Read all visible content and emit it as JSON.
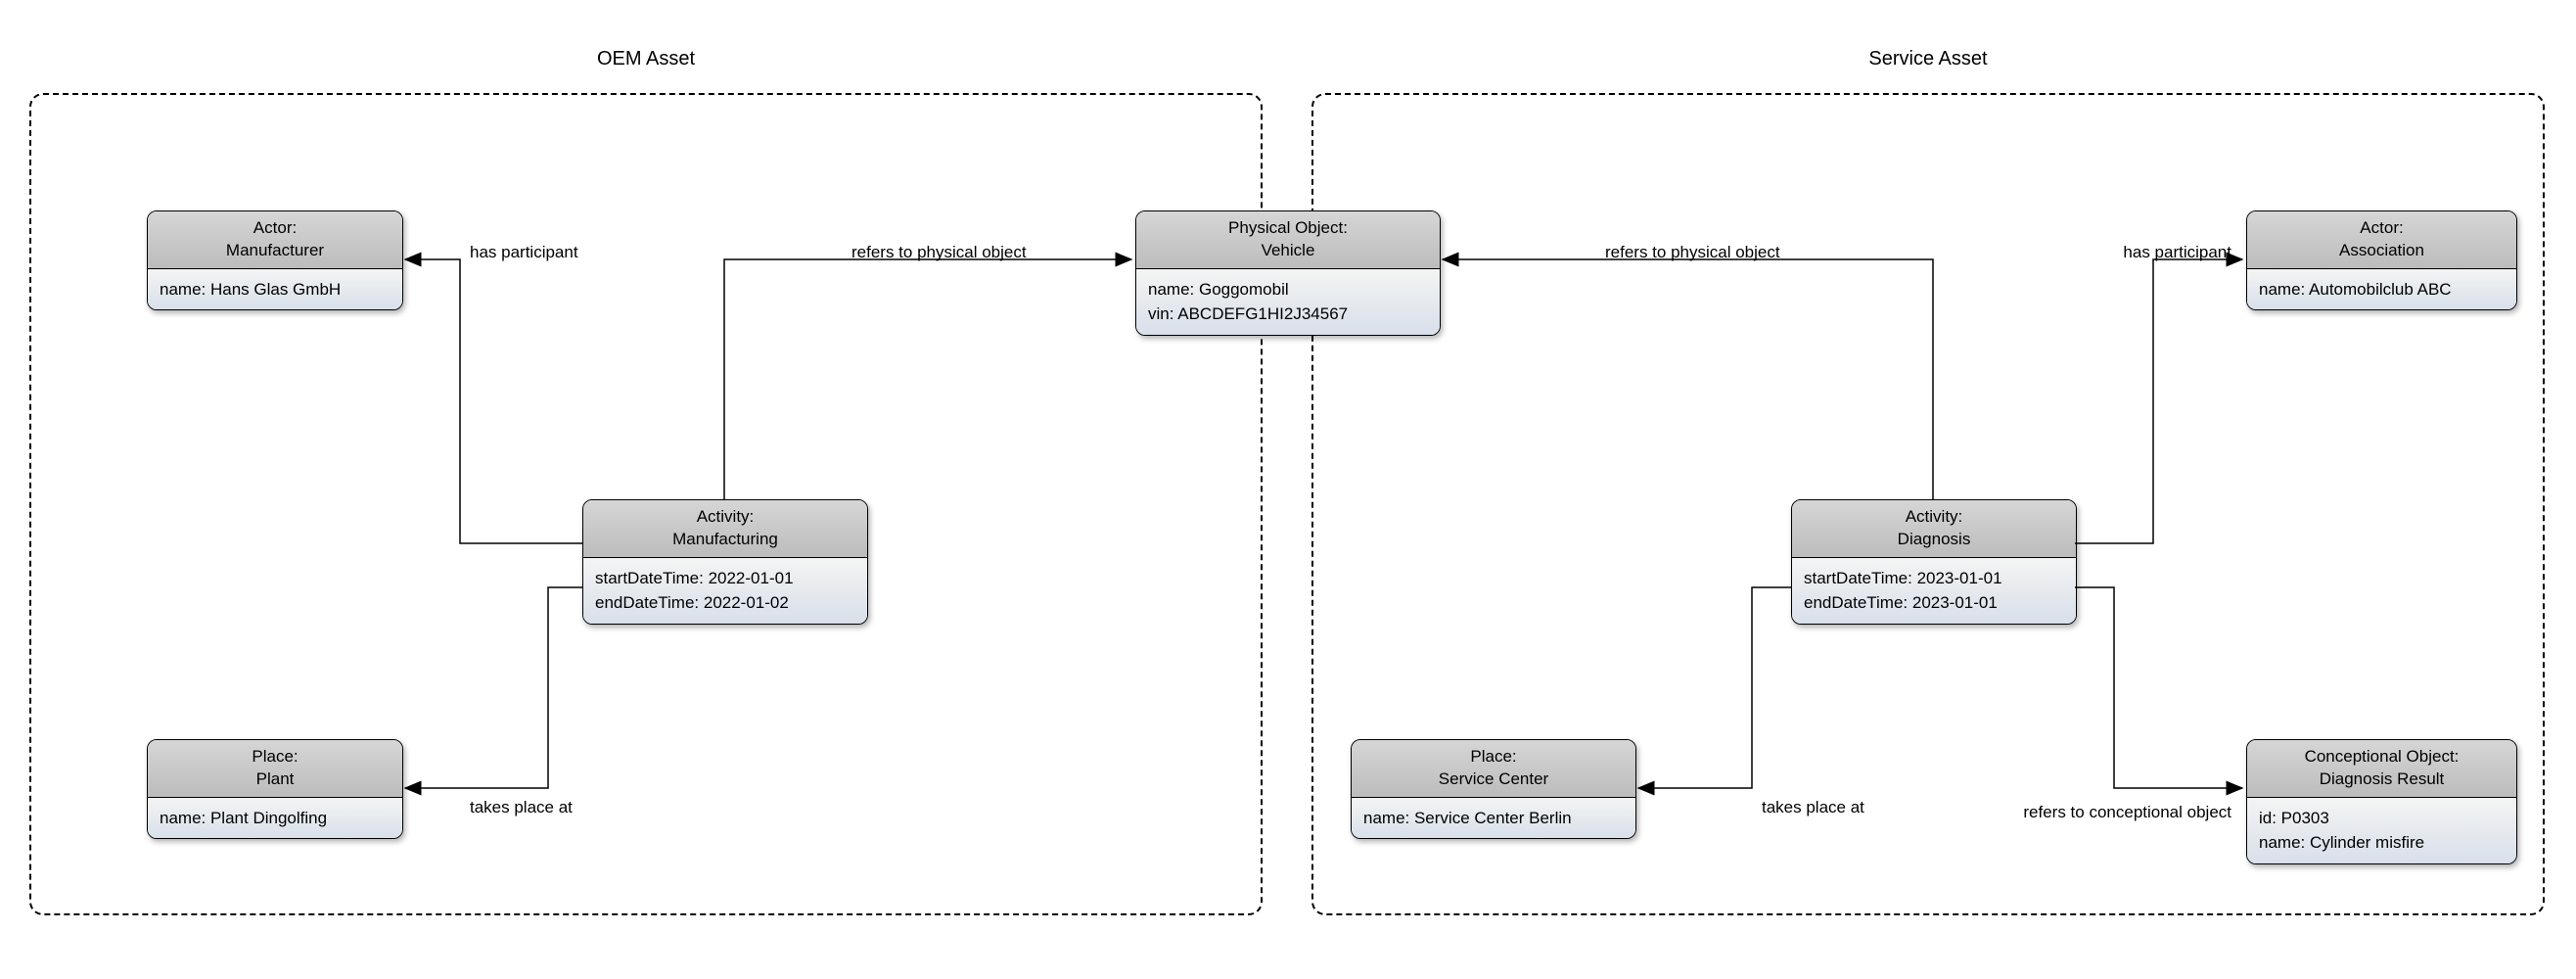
{
  "assets": {
    "oem": {
      "title": "OEM Asset"
    },
    "service": {
      "title": "Service Asset"
    }
  },
  "nodes": {
    "manufacturer": {
      "type": "Actor:",
      "subtype": "Manufacturer",
      "attrs": [
        "name: Hans Glas GmbH"
      ]
    },
    "manufacturing": {
      "type": "Activity:",
      "subtype": "Manufacturing",
      "attrs": [
        "startDateTime: 2022-01-01",
        "endDateTime: 2022-01-02"
      ]
    },
    "plant": {
      "type": "Place:",
      "subtype": "Plant",
      "attrs": [
        "name: Plant Dingolfing"
      ]
    },
    "vehicle": {
      "type": "Physical Object:",
      "subtype": "Vehicle",
      "attrs": [
        "name: Goggomobil",
        "vin: ABCDEFG1HI2J34567"
      ]
    },
    "association": {
      "type": "Actor:",
      "subtype": "Association",
      "attrs": [
        "name: Automobilclub ABC"
      ]
    },
    "diagnosis": {
      "type": "Activity:",
      "subtype": "Diagnosis",
      "attrs": [
        "startDateTime: 2023-01-01",
        "endDateTime: 2023-01-01"
      ]
    },
    "serviceCenter": {
      "type": "Place:",
      "subtype": "Service Center",
      "attrs": [
        "name: Service Center Berlin"
      ]
    },
    "diagResult": {
      "type": "Conceptional Object:",
      "subtype": "Diagnosis Result",
      "attrs": [
        "id: P0303",
        "name: Cylinder misfire"
      ]
    }
  },
  "edges": {
    "hasParticipant1": "has participant",
    "refersPhys1": "refers to physical object",
    "takesPlace1": "takes place at",
    "hasParticipant2": "has participant",
    "refersPhys2": "refers to physical object",
    "takesPlace2": "takes place at",
    "refersConcept": "refers to conceptional object"
  }
}
